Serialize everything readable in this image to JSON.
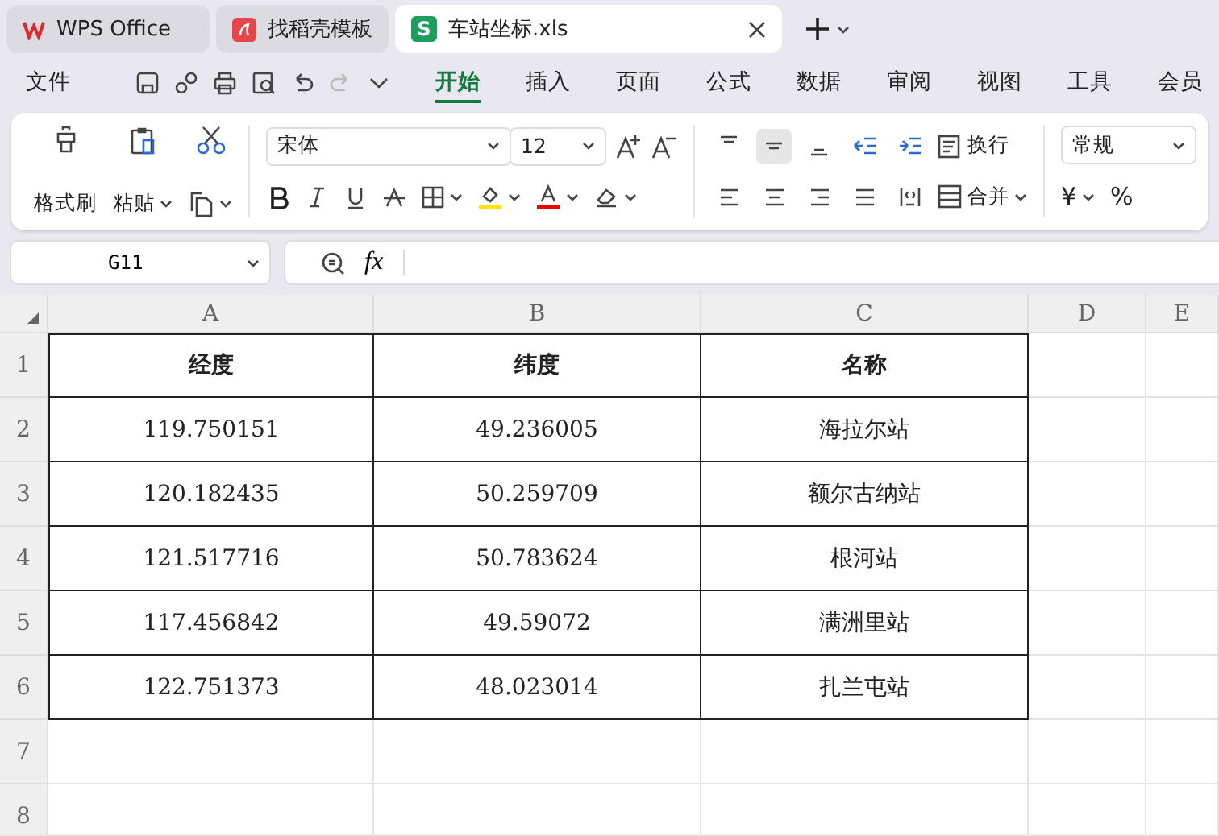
{
  "tabs": [
    {
      "kind": "wps",
      "label": "WPS Office",
      "selected": false
    },
    {
      "kind": "template",
      "label": "找稻壳模板",
      "selected": false
    },
    {
      "kind": "sheet",
      "badge": "S",
      "label": "车站坐标.xls",
      "selected": true
    }
  ],
  "menu": {
    "file_label": "文件",
    "items": [
      {
        "label": "开始",
        "selected": true
      },
      {
        "label": "插入",
        "selected": false
      },
      {
        "label": "页面",
        "selected": false
      },
      {
        "label": "公式",
        "selected": false
      },
      {
        "label": "数据",
        "selected": false
      },
      {
        "label": "审阅",
        "selected": false
      },
      {
        "label": "视图",
        "selected": false
      },
      {
        "label": "工具",
        "selected": false
      },
      {
        "label": "会员",
        "selected": false
      }
    ]
  },
  "ribbon": {
    "format_painter": "格式刷",
    "paste": "粘贴",
    "font": "宋体",
    "font_size": "12",
    "vertical_align": [
      {
        "selected": false
      },
      {
        "selected": true
      },
      {
        "selected": false
      }
    ],
    "wrap": "换行",
    "merge": "合并",
    "number_format": "常规",
    "currency": "¥",
    "percent": "%"
  },
  "formula_bar": {
    "cell_ref": "G11",
    "fx": "fx"
  },
  "sheet": {
    "columns": [
      "A",
      "B",
      "C",
      "D",
      "E"
    ],
    "rows": [
      {
        "number": "1",
        "cells": [
          "经度",
          "纬度",
          "名称"
        ]
      },
      {
        "number": "2",
        "cells": [
          "119.750151",
          "49.236005",
          "海拉尔站"
        ]
      },
      {
        "number": "3",
        "cells": [
          "120.182435",
          "50.259709",
          "额尔古纳站"
        ]
      },
      {
        "number": "4",
        "cells": [
          "121.517716",
          "50.783624",
          "根河站"
        ]
      },
      {
        "number": "5",
        "cells": [
          "117.456842",
          "49.59072",
          "满洲里站"
        ]
      },
      {
        "number": "6",
        "cells": [
          "122.751373",
          "48.023014",
          "扎兰屯站"
        ]
      },
      {
        "number": "7",
        "cells": []
      },
      {
        "number": "8",
        "cells": []
      }
    ]
  }
}
